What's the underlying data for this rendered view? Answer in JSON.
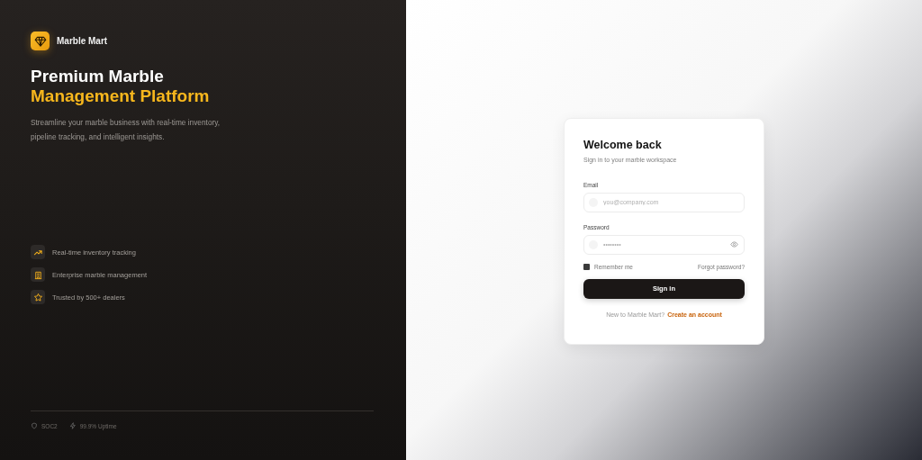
{
  "brand": {
    "name": "Marble Mart"
  },
  "hero": {
    "title_line_1": "Premium Marble",
    "title_line_2": "Management Platform",
    "description": "Streamline your marble business with real-time inventory, pipeline tracking, and intelligent insights."
  },
  "features": [
    {
      "kind": "trend",
      "label": "Real-time inventory tracking"
    },
    {
      "kind": "building",
      "label": "Enterprise marble management"
    },
    {
      "kind": "star",
      "label": "Trusted by 500+ dealers"
    }
  ],
  "footer": [
    {
      "kind": "shield",
      "label": "SOC2"
    },
    {
      "kind": "bolt",
      "label": "99.9% Uptime"
    }
  ],
  "login": {
    "title": "Welcome back",
    "subtitle": "Sign in to your marble workspace",
    "email": {
      "label": "Email",
      "placeholder": "you@company.com"
    },
    "password": {
      "label": "Password",
      "placeholder": "••••••••"
    },
    "remember": {
      "label": "Remember me",
      "checked": false
    },
    "forgot": "Forgot password?",
    "submit": "Sign in",
    "signup_prompt": "New to Marble Mart?",
    "signup_link": "Create an account"
  }
}
